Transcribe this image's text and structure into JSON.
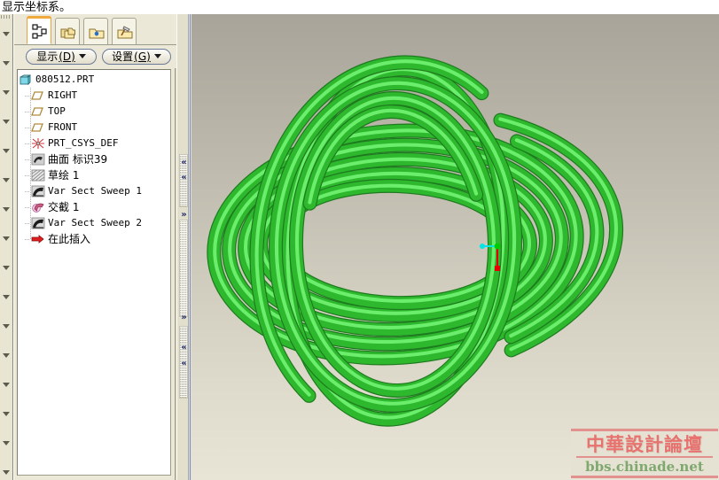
{
  "status": {
    "message": "显示坐标系。"
  },
  "left_strip": {
    "name": "collapsed-toolbar-strip",
    "arrow_icon": "chevron-down-icon",
    "arrow_count": 16
  },
  "tree_panel": {
    "tabs": [
      {
        "label": "",
        "icon": "model-tree-icon",
        "active": true
      },
      {
        "label": "",
        "icon": "folder-copy-icon",
        "active": false
      },
      {
        "label": "",
        "icon": "folder-star-icon",
        "active": false
      },
      {
        "label": "",
        "icon": "folder-tools-icon",
        "active": false
      }
    ],
    "menu_buttons": [
      {
        "label": "显示",
        "mnemonic": "(D)",
        "caret": "caret-down-icon"
      },
      {
        "label": "设置",
        "mnemonic": "(G)",
        "caret": "caret-down-icon"
      }
    ],
    "items": [
      {
        "label": "080512.PRT",
        "icon": "part-icon",
        "depth": 0,
        "cjk": false
      },
      {
        "label": "RIGHT",
        "icon": "datum-plane-icon",
        "depth": 1,
        "cjk": false
      },
      {
        "label": "TOP",
        "icon": "datum-plane-icon",
        "depth": 1,
        "cjk": false
      },
      {
        "label": "FRONT",
        "icon": "datum-plane-icon",
        "depth": 1,
        "cjk": false
      },
      {
        "label": "PRT_CSYS_DEF",
        "icon": "csys-icon",
        "depth": 1,
        "cjk": false
      },
      {
        "label": "曲面 标识39",
        "icon": "surface-icon",
        "depth": 1,
        "cjk": true
      },
      {
        "label": "草绘 1",
        "icon": "sketch-icon",
        "depth": 1,
        "cjk": true
      },
      {
        "label": "Var Sect Sweep 1",
        "icon": "sweep-icon",
        "depth": 1,
        "cjk": false
      },
      {
        "label": "交截 1",
        "icon": "intersect-icon",
        "depth": 1,
        "cjk": true
      },
      {
        "label": "Var Sect Sweep 2",
        "icon": "sweep-icon",
        "depth": 1,
        "cjk": false
      },
      {
        "label": "在此插入",
        "icon": "insert-here-icon",
        "depth": 1,
        "cjk": true
      }
    ]
  },
  "splitter": {
    "name": "panel-splitter",
    "collapse_icon": "double-chevron-left-icon",
    "expand_icon": "double-chevron-right-icon"
  },
  "viewport": {
    "name": "3d-model-viewport",
    "model_color": "#2eb82e",
    "model_highlight": "#6ff06f",
    "model_shadow": "#1e7a1e",
    "background_top": "#a8a49a",
    "background_bottom": "#e8e4d6",
    "coordinate_triad": {
      "origin_color": "#00cc00",
      "x_axis_color": "#00e5e5",
      "y_axis_color": "#e60000",
      "x_label": "",
      "y_label": ""
    }
  },
  "watermark": {
    "line1": "中華設計論壇",
    "line2": "bbs.chinade.net",
    "line1_color": "#e8726f",
    "line2_color": "#7fa86f"
  }
}
